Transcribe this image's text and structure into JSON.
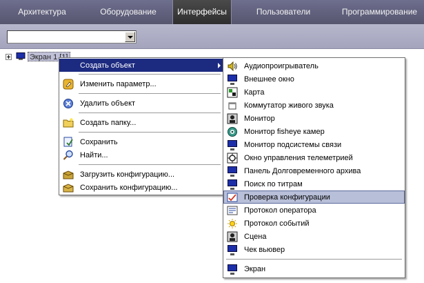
{
  "tabs": [
    {
      "label": "Архитектура",
      "active": false
    },
    {
      "label": "Оборудование",
      "active": false
    },
    {
      "label": "Интерфейсы",
      "active": true
    },
    {
      "label": "Пользователи",
      "active": false
    },
    {
      "label": "Программирование",
      "active": false
    }
  ],
  "toolbar": {
    "combo_value": ""
  },
  "tree": {
    "root_label": "Экран 1 [1]",
    "root_icon": "monitor-icon"
  },
  "context_menu": {
    "create": "Создать объект",
    "edit_param": "Изменить параметр...",
    "delete": "Удалить объект",
    "create_folder": "Создать папку...",
    "save": "Сохранить",
    "find": "Найти...",
    "load_config": "Загрузить конфигурацию...",
    "save_config": "Сохранить конфигурацию..."
  },
  "submenu": {
    "selected_index": 10,
    "items": [
      {
        "label": "Аудиопроигрыватель",
        "icon": "speaker-icon"
      },
      {
        "label": "Внешнее окно",
        "icon": "monitor-icon"
      },
      {
        "label": "Карта",
        "icon": "map-icon"
      },
      {
        "label": "Коммутатор живого звука",
        "icon": "window-icon"
      },
      {
        "label": "Монитор",
        "icon": "camera-monitor-icon"
      },
      {
        "label": "Монитор fisheye камер",
        "icon": "fisheye-icon"
      },
      {
        "label": "Монитор подсистемы связи",
        "icon": "monitor-icon"
      },
      {
        "label": "Окно управления телеметрией",
        "icon": "telemetry-icon"
      },
      {
        "label": "Панель Долговременного архива",
        "icon": "monitor-icon"
      },
      {
        "label": "Поиск по титрам",
        "icon": "monitor-icon"
      },
      {
        "label": "Проверка конфигурации",
        "icon": "config-check-icon"
      },
      {
        "label": "Протокол оператора",
        "icon": "list-icon"
      },
      {
        "label": "Протокол событий",
        "icon": "sun-icon"
      },
      {
        "label": "Сцена",
        "icon": "scene-icon"
      },
      {
        "label": "Чек вьювер",
        "icon": "monitor-icon"
      },
      {
        "label": "Экран",
        "icon": "screen-icon"
      }
    ]
  },
  "colors": {
    "tabbar": "#5e5e7a",
    "active_tab": "#3a3a3a",
    "toolbar": "#aeaec6",
    "menu_highlight": "#1c2a80",
    "submenu_highlight": "#b8bfd8"
  }
}
